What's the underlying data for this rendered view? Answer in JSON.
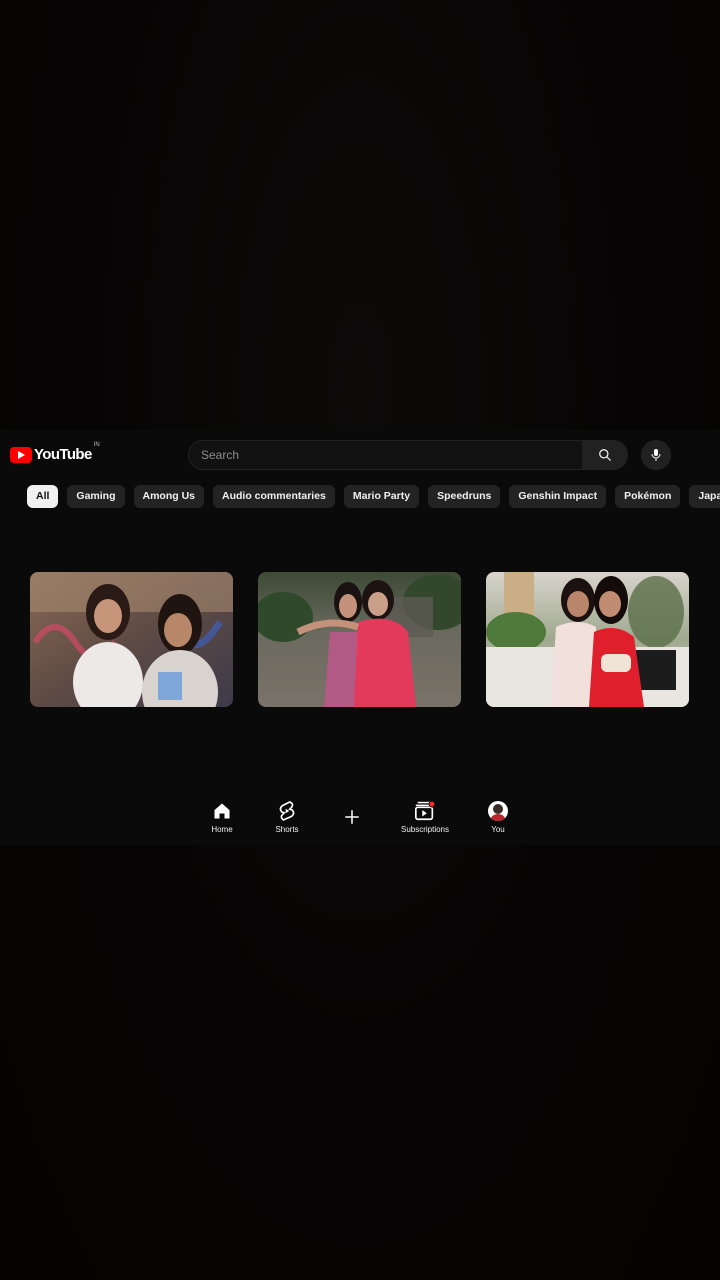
{
  "header": {
    "logo_text": "YouTube",
    "region": "IN",
    "search_placeholder": "Search",
    "brand_color": "#ff0000",
    "search_icon": "search-icon",
    "mic_icon": "mic-icon"
  },
  "chips": [
    {
      "label": "All",
      "active": true
    },
    {
      "label": "Gaming"
    },
    {
      "label": "Among Us"
    },
    {
      "label": "Audio commentaries"
    },
    {
      "label": "Mario Party"
    },
    {
      "label": "Speedruns"
    },
    {
      "label": "Genshin Impact"
    },
    {
      "label": "Pokémon"
    },
    {
      "label": "Japanese Cuisine"
    }
  ],
  "thumbnails": [
    {
      "name": "video-thumbnail-1"
    },
    {
      "name": "video-thumbnail-2"
    },
    {
      "name": "video-thumbnail-3"
    }
  ],
  "bottom_nav": {
    "home": {
      "label": "Home",
      "icon": "home-icon"
    },
    "shorts": {
      "label": "Shorts",
      "icon": "shorts-icon"
    },
    "create": {
      "icon": "plus-icon"
    },
    "subscriptions": {
      "label": "Subscriptions",
      "icon": "subscriptions-icon",
      "has_notification_dot": true
    },
    "you": {
      "label": "You",
      "icon": "avatar"
    }
  }
}
